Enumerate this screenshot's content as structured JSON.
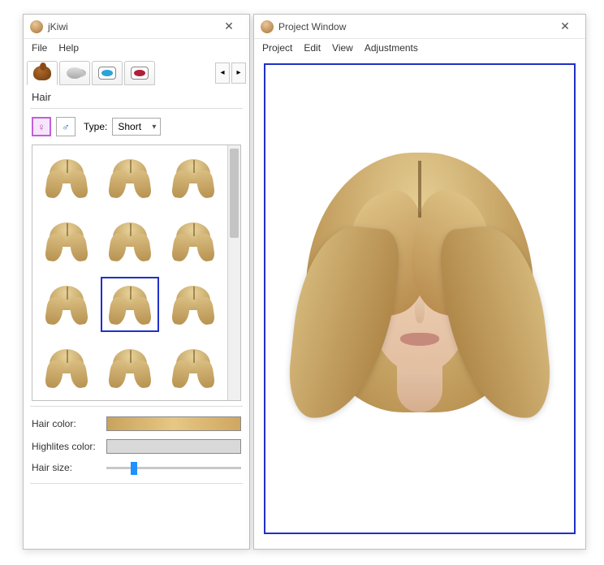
{
  "left_window": {
    "title": "jKiwi",
    "menubar": [
      "File",
      "Help"
    ],
    "tabs": [
      {
        "name": "hair-tab",
        "icon": "hair-icon",
        "selected": true
      },
      {
        "name": "powder-tab",
        "icon": "powder-icon",
        "selected": false
      },
      {
        "name": "eyeshadow-tab",
        "icon": "eyeshadow-icon",
        "selected": false
      },
      {
        "name": "lipstick-tab",
        "icon": "lipstick-icon",
        "selected": false
      }
    ],
    "section_label": "Hair",
    "gender": {
      "female_selected": true,
      "male_selected": false
    },
    "type_label": "Type:",
    "type_value": "Short",
    "thumbnails": {
      "count": 12,
      "selected_index": 7
    },
    "controls": {
      "hair_color_label": "Hair color:",
      "highlights_label": "Highlites color:",
      "hair_size_label": "Hair size:",
      "hair_size_value_pct": 18
    }
  },
  "right_window": {
    "title": "Project Window",
    "menubar": [
      "Project",
      "Edit",
      "View",
      "Adjustments"
    ]
  }
}
